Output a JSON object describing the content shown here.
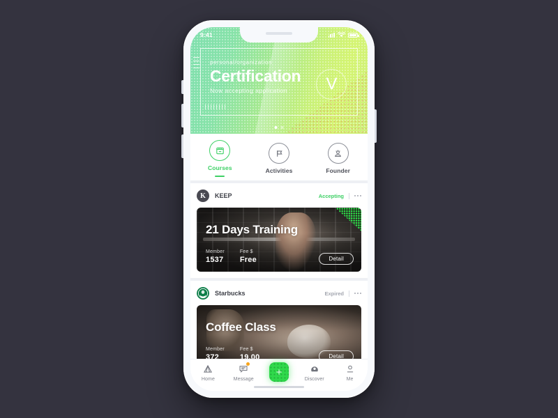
{
  "background_color": "#34333f",
  "accent_color": "#3ed065",
  "status_bar": {
    "time": "9:41",
    "signal_icon": "signal-bars-icon",
    "wifi_icon": "wifi-icon",
    "battery_icon": "battery-icon"
  },
  "hero": {
    "kicker": "personal/organization",
    "title": "Certification",
    "subtitle": "Now accepting application",
    "badge_text": "V",
    "gradient_from": "#7fdfae",
    "gradient_to": "#d4f471",
    "pagination": {
      "total": 2,
      "active_index": 0
    }
  },
  "tabs": [
    {
      "label": "Courses",
      "icon": "book-icon",
      "active": true
    },
    {
      "label": "Activities",
      "icon": "flag-icon",
      "active": false
    },
    {
      "label": "Founder",
      "icon": "person-idea-icon",
      "active": false
    }
  ],
  "cards": [
    {
      "brand": "KEEP",
      "logo_icon": "keep-logo-icon",
      "logo_letter": "K",
      "status": "Accepting",
      "status_type": "accepting",
      "more_icon": "more-dots-icon",
      "title": "21 Days Training",
      "stats": [
        {
          "label": "Member",
          "value": "1537"
        },
        {
          "label": "Fee $",
          "value": "Free"
        }
      ],
      "action_label": "Detail",
      "image_alt": "woman-weight-training-gym"
    },
    {
      "brand": "Starbucks",
      "logo_icon": "starbucks-siren-icon",
      "logo_letter": "",
      "status": "Expired",
      "status_type": "expired",
      "more_icon": "more-dots-icon",
      "title": "Coffee Class",
      "stats": [
        {
          "label": "Member",
          "value": "372"
        },
        {
          "label": "Fee $",
          "value": "19.00"
        }
      ],
      "action_label": "Detail",
      "image_alt": "pour-over-coffee-brewing"
    }
  ],
  "bottom_nav": [
    {
      "label": "Home",
      "icon": "home-icon",
      "badge": false
    },
    {
      "label": "Message",
      "icon": "message-icon",
      "badge": true
    },
    {
      "label": "",
      "icon": "add-sparkle-icon",
      "center": true
    },
    {
      "label": "Discover",
      "icon": "discover-icon",
      "badge": false
    },
    {
      "label": "Me",
      "icon": "person-icon",
      "badge": false
    }
  ]
}
